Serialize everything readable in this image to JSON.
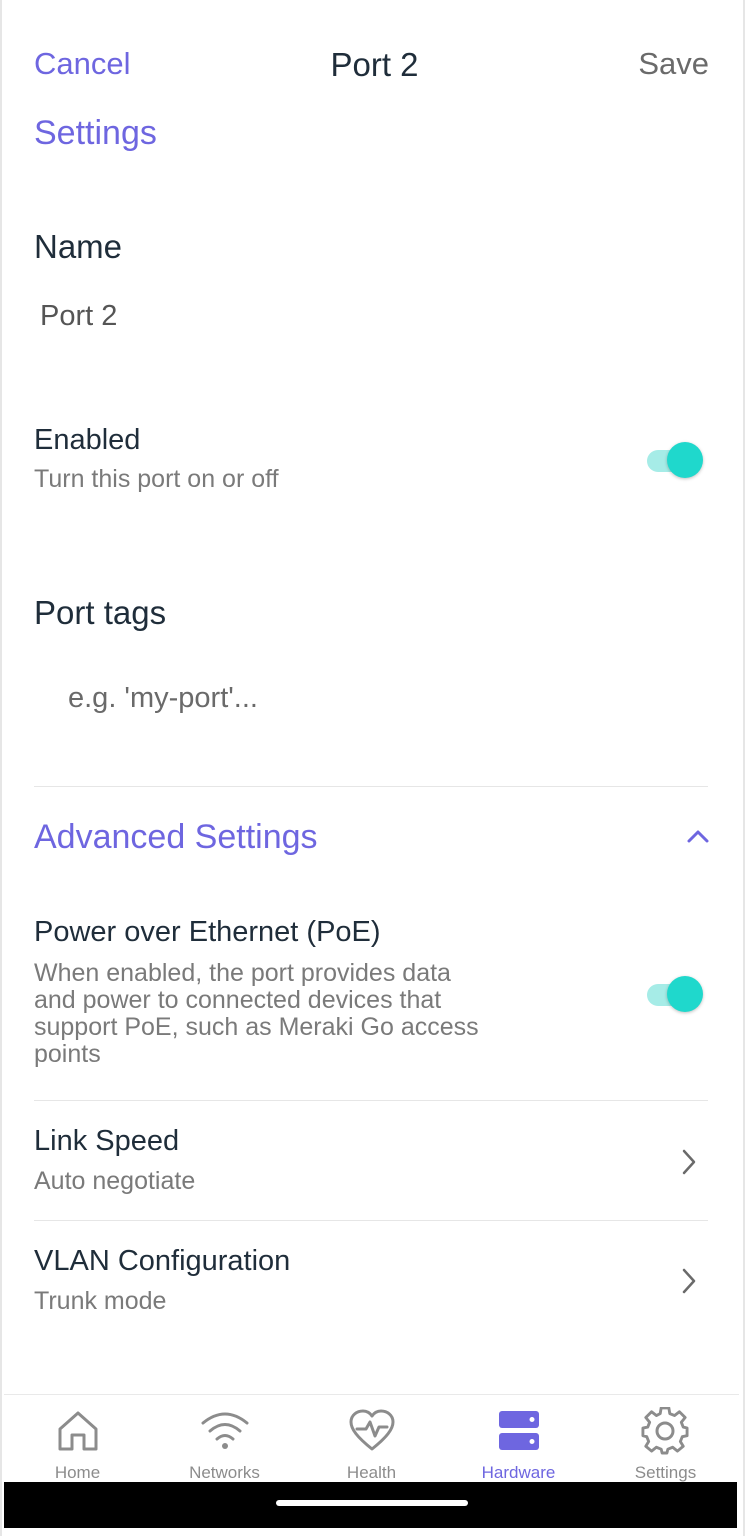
{
  "header": {
    "cancel_label": "Cancel",
    "title": "Port 2",
    "save_label": "Save"
  },
  "settings_title": "Settings",
  "name": {
    "label": "Name",
    "value": "Port 2"
  },
  "enabled": {
    "title": "Enabled",
    "subtitle": "Turn this port on or off",
    "on": true
  },
  "port_tags": {
    "label": "Port tags",
    "placeholder": "e.g. 'my-port'..."
  },
  "advanced": {
    "title": "Advanced Settings",
    "expanded": true,
    "icon": "chevron-up-icon"
  },
  "poe": {
    "title": "Power over Ethernet (PoE)",
    "subtitle_lines": [
      "When enabled, the port provides data",
      "and power to connected devices that",
      "support PoE, such as Meraki Go access",
      "points"
    ],
    "on": true
  },
  "link_speed": {
    "title": "Link Speed",
    "subtitle": "Auto negotiate"
  },
  "vlan": {
    "title": "VLAN Configuration",
    "subtitle": "Trunk mode"
  },
  "tabs": [
    {
      "label": "Home",
      "icon": "home-icon",
      "active": false
    },
    {
      "label": "Networks",
      "icon": "wifi-icon",
      "active": false
    },
    {
      "label": "Health",
      "icon": "heart-pulse-icon",
      "active": false
    },
    {
      "label": "Hardware",
      "icon": "server-icon",
      "active": true
    },
    {
      "label": "Settings",
      "icon": "gear-icon",
      "active": false
    }
  ],
  "colors": {
    "accent": "#6e66e0",
    "toggle_on": "#1fd8cc",
    "toggle_track": "#a6ece7",
    "text_dark": "#1f2d3a",
    "text_muted": "#7a7a7a"
  }
}
